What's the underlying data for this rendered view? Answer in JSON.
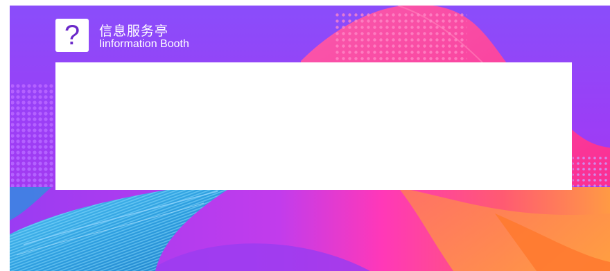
{
  "header": {
    "logo_glyph": "?",
    "logo_icon": "question-mark-icon",
    "title_cn": "信息服务亭",
    "title_en": "Iinformation Booth"
  },
  "content": {
    "text": ""
  },
  "colors": {
    "primary_purple": "#8a4dfa",
    "magenta": "#ff3fb5",
    "orange": "#ff8a3c",
    "blue": "#2aa8e8",
    "logo_text": "#6a28c9"
  }
}
